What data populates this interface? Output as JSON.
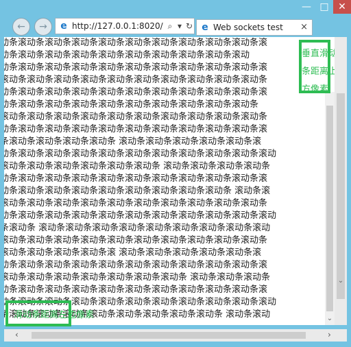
{
  "window": {
    "minimize_symbol": "—",
    "maximize_symbol": "□",
    "close_symbol": "✕"
  },
  "nav": {
    "back_symbol": "←",
    "forward_symbol": "→"
  },
  "address_bar": {
    "url": "http://127.0.0.1:8020/",
    "search_symbol": "⌕",
    "dropdown_symbol": "▾",
    "refresh_symbol": "↻"
  },
  "tab": {
    "title": "Web sockets test",
    "close_symbol": "×"
  },
  "content": {
    "lines": [
      "动条滚动条滚动条滚动条滚动条滚动条滚动条滚动条滚动条滚动条滚",
      "动条滚动条滚动条滚动条滚动条滚动条滚动条滚动条滚动条滚动",
      "动条滚动条滚动条滚动条滚动条滚动条滚动条滚动条滚动条滚动条滚",
      "滚动条滚动条滚动条滚动条滚动条滚动条滚动条滚动条滚动条滚动条",
      "动条滚动条滚动条滚动条滚动条滚动条滚动条滚动条滚动条滚动条滚",
      "动条滚动条滚动条滚动条滚动条滚动条滚动条滚动条滚动条滚动条",
      "滚动条滚动条滚动条滚动条滚动条滚动条滚动条滚动条滚动条滚动条",
      "动条滚动条滚动条滚动条滚动条滚动条滚动条滚动条滚动条滚动条滚",
      "条滚动条滚动条滚动条滚动条 滚动条滚动条滚动条滚动条滚动条滚",
      "动条滚动条滚动条滚动条滚动条滚动条滚动条滚动条滚动条滚动条滚动",
      "滚动条滚动条滚动条滚动条滚动条滚动条 滚动条滚动条滚动条滚动条",
      "动条滚动条滚动条滚动条滚动条滚动条滚动条滚动条滚动条滚动条滚",
      "动条滚动条滚动条滚动条滚动条滚动条滚动条滚动条滚动条 滚动条滚",
      "滚动条滚动条滚动条滚动条滚动条滚动条滚动条滚动条滚动条滚动条",
      "动条滚动条滚动条滚动条滚动条滚动条滚动条滚动条滚动条滚动条滚动",
      "条滚动条 滚动条滚动条滚动条滚动条滚动条滚动条滚动条滚动条滚动",
      "滚动条滚动条滚动条滚动条滚动条滚动条滚动条滚动条滚动条滚动条",
      "滚动条滚动条滚动条滚动条滚 滚动条滚动条滚动条滚动条滚动条滚",
      "动条滚动条滚动条滚动条滚动条滚动条滚动条滚动条滚动条滚动条滚",
      "滚动条滚动条滚动条滚动条滚动条滚动条滚动条 滚动条滚动条滚动条",
      "动条滚动条滚动条滚动条滚动条滚动条滚动条滚动条滚动条滚动条滚",
      "动条滚动条滚动条滚动条滚动条滚动条滚动条滚动条滚动条滚动条滚动",
      "条滚动条滚动条滚动条滚动条滚动条滚动条滚动条滚动条 滚动条滚动"
    ]
  },
  "annotations": {
    "vertical_note": "垂直滑动条距离上方像素",
    "horizontal_note": "滑动条距离左边像素"
  },
  "scroll": {
    "up_symbol": "⌃",
    "down_symbol": "⌄",
    "left_symbol": "‹",
    "right_symbol": "›"
  },
  "colors": {
    "annotation": "#2ebc53",
    "chrome": "#74c3e2",
    "close_button": "#c7504b"
  }
}
